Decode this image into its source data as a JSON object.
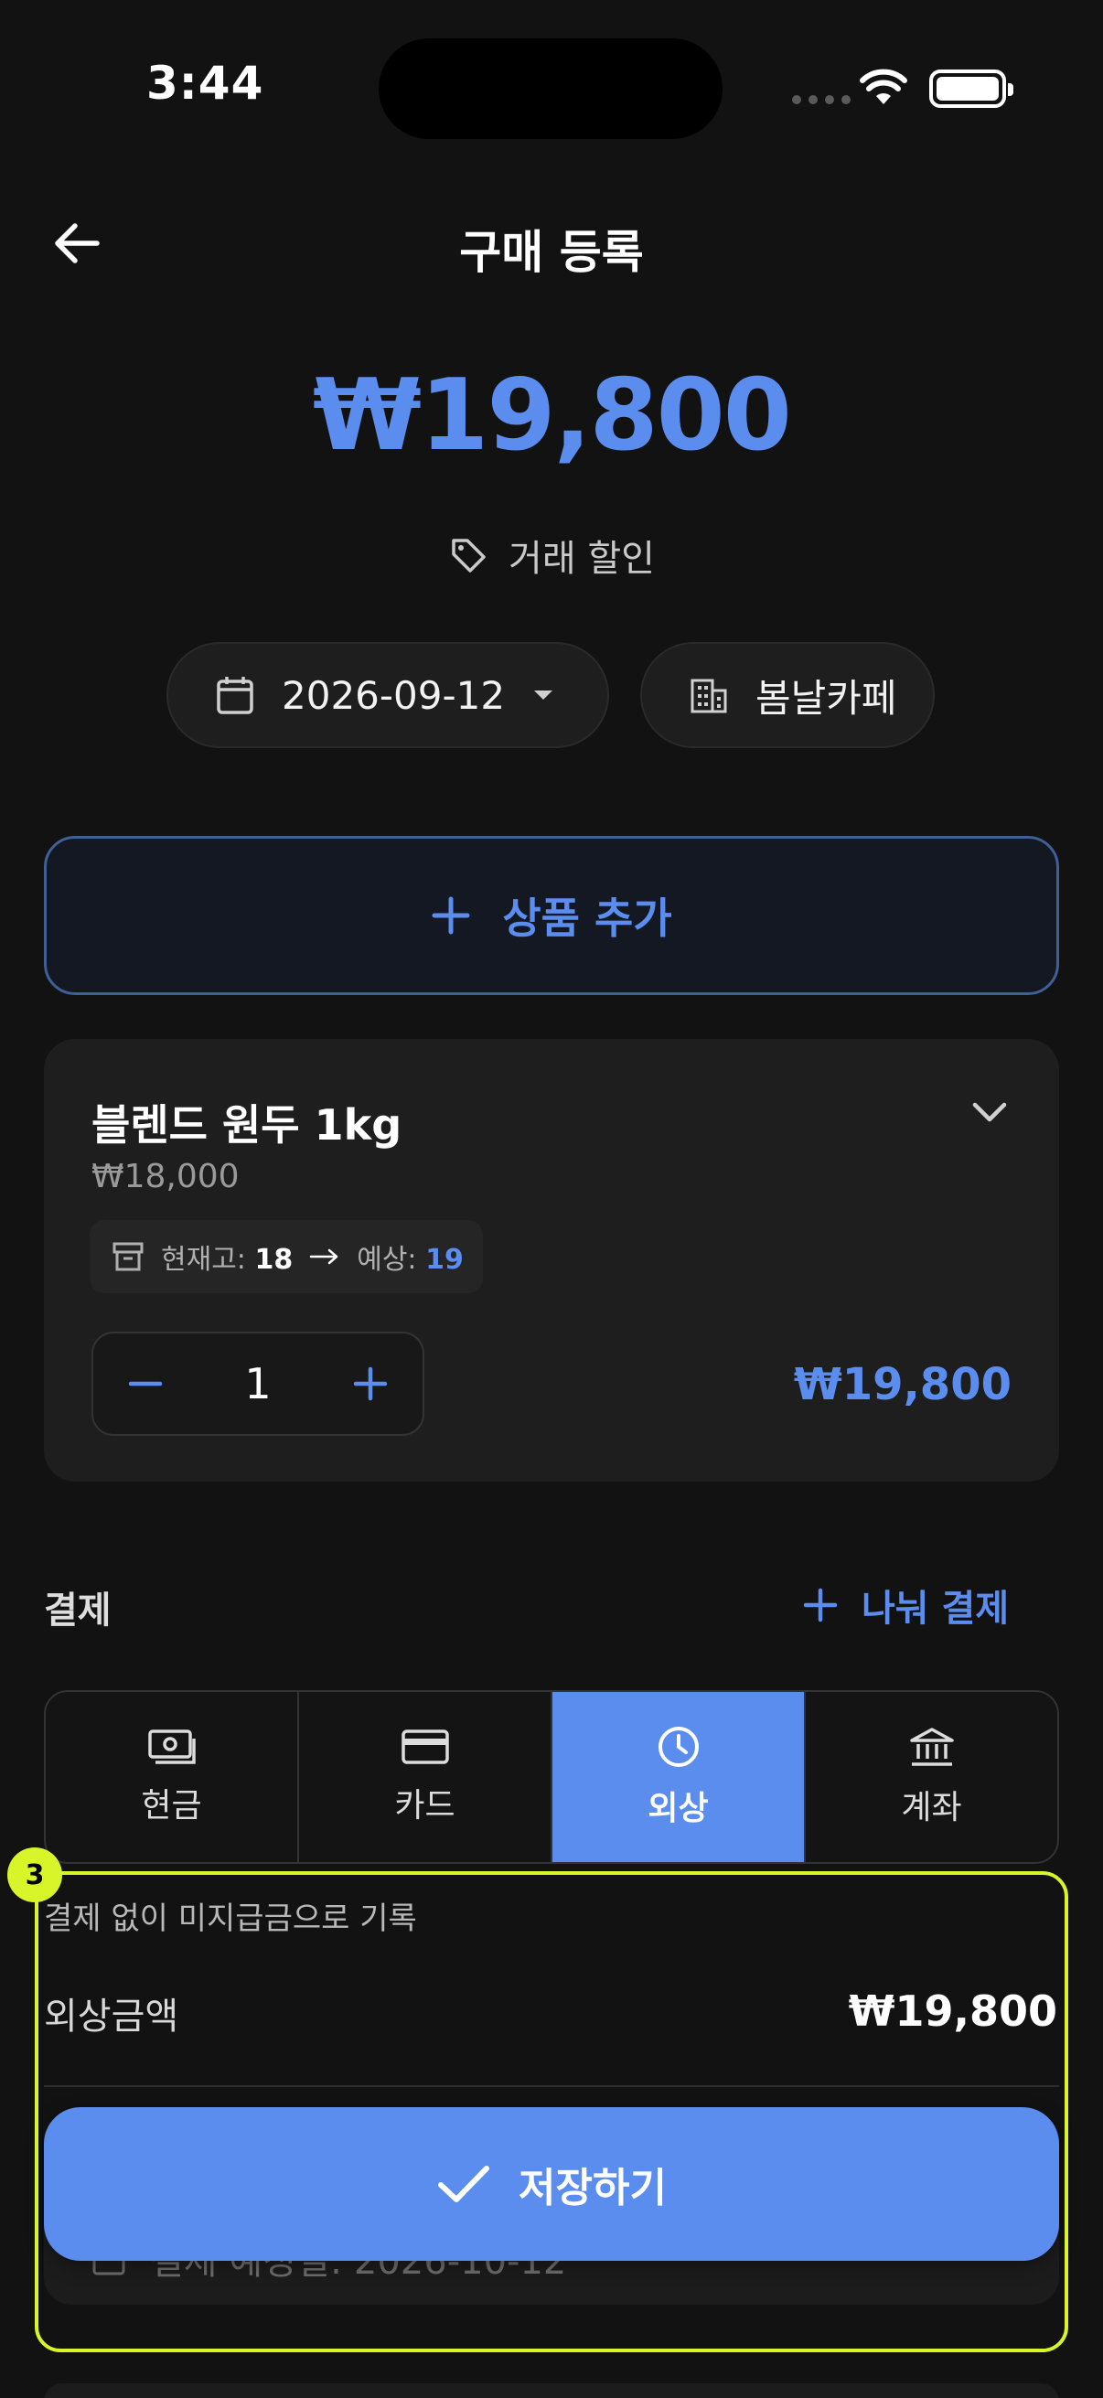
{
  "status_bar": {
    "time": "3:44"
  },
  "header": {
    "title": "구매 등록"
  },
  "summary": {
    "amount": "₩19,800",
    "discount_label": "거래 할인"
  },
  "chips": {
    "date": "2026-09-12",
    "store": "봄날카페"
  },
  "add_product": {
    "label": "상품 추가"
  },
  "product": {
    "name": "블렌드 원두 1kg",
    "unit_price": "₩18,000",
    "stock_label": "현재고:",
    "stock_value": "18",
    "expected_label": "예상:",
    "expected_value": "19",
    "quantity": "1",
    "total": "₩19,800"
  },
  "payment": {
    "label": "결제",
    "split_label": "나눠 결제",
    "methods": [
      {
        "label": "현금",
        "icon": "cash-icon"
      },
      {
        "label": "카드",
        "icon": "card-icon"
      },
      {
        "label": "외상",
        "icon": "clock-icon",
        "selected": true
      },
      {
        "label": "계좌",
        "icon": "bank-icon"
      }
    ],
    "note": "결제 없이 미지급금으로 기록",
    "credit_label": "외상금액",
    "credit_value": "₩19,800",
    "due_text": "결제 예정일: 2026-10-12"
  },
  "annotation": {
    "badge": "3"
  },
  "save_button": {
    "label": "저장하기"
  },
  "colors": {
    "accent": "#5b8def",
    "background": "#121212",
    "card": "#1e1e1e",
    "highlight": "#d8f52a"
  }
}
